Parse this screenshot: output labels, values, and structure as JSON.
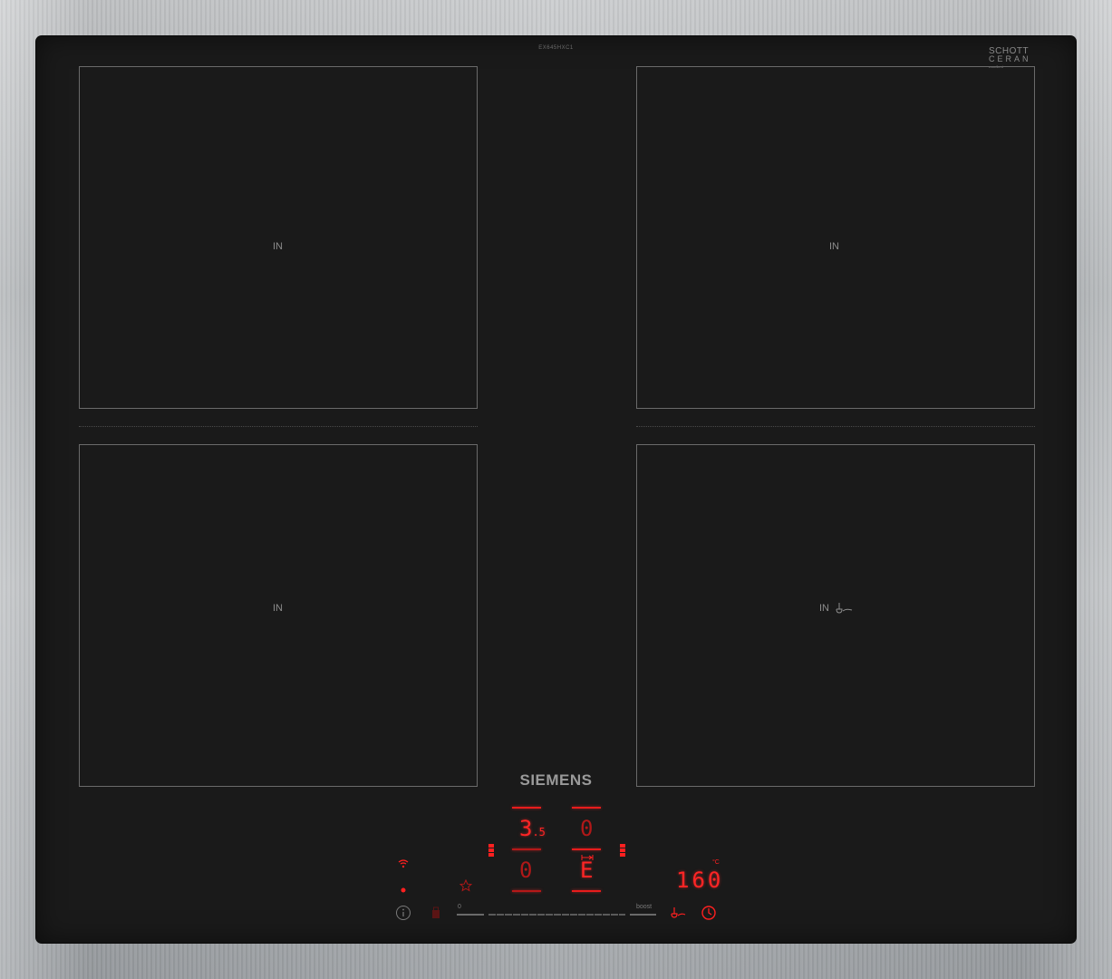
{
  "cooktop": {
    "model_label": "EX645HXC1",
    "glass_brand": {
      "line1": "SCHOTT",
      "line2": "CERAN",
      "line3": "excellent"
    },
    "brand": "SIEMENS",
    "zones": [
      {
        "id": "front-left-top",
        "label": "IN"
      },
      {
        "id": "rear-right",
        "label": "IN"
      },
      {
        "id": "front-left",
        "label": "IN"
      },
      {
        "id": "front-right",
        "label": "IN"
      }
    ]
  },
  "controls": {
    "display_top_left": "3",
    "display_top_left_sub": ".5",
    "display_top_right": "0",
    "display_bottom_left": "0",
    "display_bottom_right": "E",
    "temperature": "160",
    "temperature_unit": "°C",
    "slider_min": "0",
    "slider_max": "boost"
  },
  "icons": {
    "wifi": "wifi-icon",
    "info": "info-icon",
    "favorite": "star-icon",
    "child_lock": "lock-icon",
    "frying_sensor": "pan-sensor-icon",
    "timer": "timer-icon"
  },
  "colors": {
    "glass": "#1a1a1a",
    "display_red": "#ff2525",
    "zone_outline": "#6a6a6a",
    "frame": "#b0b3b6"
  }
}
